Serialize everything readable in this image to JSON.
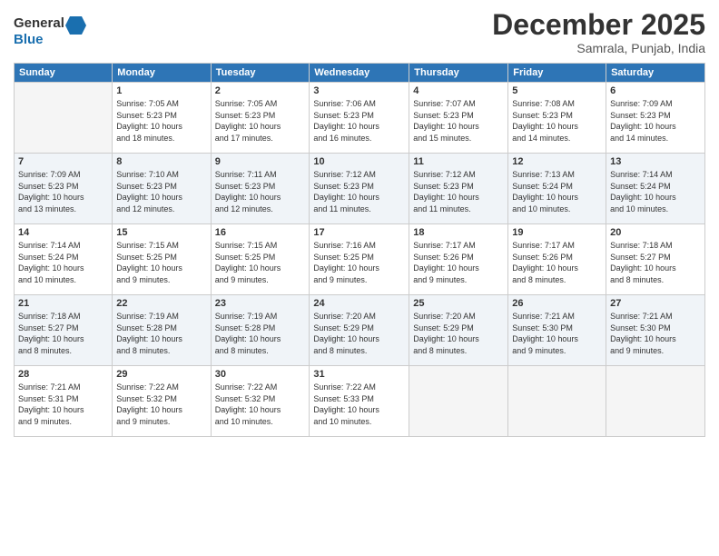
{
  "header": {
    "logo_line1": "General",
    "logo_line2": "Blue",
    "month": "December 2025",
    "location": "Samrala, Punjab, India"
  },
  "weekdays": [
    "Sunday",
    "Monday",
    "Tuesday",
    "Wednesday",
    "Thursday",
    "Friday",
    "Saturday"
  ],
  "weeks": [
    [
      {
        "day": "",
        "info": ""
      },
      {
        "day": "1",
        "info": "Sunrise: 7:05 AM\nSunset: 5:23 PM\nDaylight: 10 hours\nand 18 minutes."
      },
      {
        "day": "2",
        "info": "Sunrise: 7:05 AM\nSunset: 5:23 PM\nDaylight: 10 hours\nand 17 minutes."
      },
      {
        "day": "3",
        "info": "Sunrise: 7:06 AM\nSunset: 5:23 PM\nDaylight: 10 hours\nand 16 minutes."
      },
      {
        "day": "4",
        "info": "Sunrise: 7:07 AM\nSunset: 5:23 PM\nDaylight: 10 hours\nand 15 minutes."
      },
      {
        "day": "5",
        "info": "Sunrise: 7:08 AM\nSunset: 5:23 PM\nDaylight: 10 hours\nand 14 minutes."
      },
      {
        "day": "6",
        "info": "Sunrise: 7:09 AM\nSunset: 5:23 PM\nDaylight: 10 hours\nand 14 minutes."
      }
    ],
    [
      {
        "day": "7",
        "info": "Sunrise: 7:09 AM\nSunset: 5:23 PM\nDaylight: 10 hours\nand 13 minutes."
      },
      {
        "day": "8",
        "info": "Sunrise: 7:10 AM\nSunset: 5:23 PM\nDaylight: 10 hours\nand 12 minutes."
      },
      {
        "day": "9",
        "info": "Sunrise: 7:11 AM\nSunset: 5:23 PM\nDaylight: 10 hours\nand 12 minutes."
      },
      {
        "day": "10",
        "info": "Sunrise: 7:12 AM\nSunset: 5:23 PM\nDaylight: 10 hours\nand 11 minutes."
      },
      {
        "day": "11",
        "info": "Sunrise: 7:12 AM\nSunset: 5:23 PM\nDaylight: 10 hours\nand 11 minutes."
      },
      {
        "day": "12",
        "info": "Sunrise: 7:13 AM\nSunset: 5:24 PM\nDaylight: 10 hours\nand 10 minutes."
      },
      {
        "day": "13",
        "info": "Sunrise: 7:14 AM\nSunset: 5:24 PM\nDaylight: 10 hours\nand 10 minutes."
      }
    ],
    [
      {
        "day": "14",
        "info": "Sunrise: 7:14 AM\nSunset: 5:24 PM\nDaylight: 10 hours\nand 10 minutes."
      },
      {
        "day": "15",
        "info": "Sunrise: 7:15 AM\nSunset: 5:25 PM\nDaylight: 10 hours\nand 9 minutes."
      },
      {
        "day": "16",
        "info": "Sunrise: 7:15 AM\nSunset: 5:25 PM\nDaylight: 10 hours\nand 9 minutes."
      },
      {
        "day": "17",
        "info": "Sunrise: 7:16 AM\nSunset: 5:25 PM\nDaylight: 10 hours\nand 9 minutes."
      },
      {
        "day": "18",
        "info": "Sunrise: 7:17 AM\nSunset: 5:26 PM\nDaylight: 10 hours\nand 9 minutes."
      },
      {
        "day": "19",
        "info": "Sunrise: 7:17 AM\nSunset: 5:26 PM\nDaylight: 10 hours\nand 8 minutes."
      },
      {
        "day": "20",
        "info": "Sunrise: 7:18 AM\nSunset: 5:27 PM\nDaylight: 10 hours\nand 8 minutes."
      }
    ],
    [
      {
        "day": "21",
        "info": "Sunrise: 7:18 AM\nSunset: 5:27 PM\nDaylight: 10 hours\nand 8 minutes."
      },
      {
        "day": "22",
        "info": "Sunrise: 7:19 AM\nSunset: 5:28 PM\nDaylight: 10 hours\nand 8 minutes."
      },
      {
        "day": "23",
        "info": "Sunrise: 7:19 AM\nSunset: 5:28 PM\nDaylight: 10 hours\nand 8 minutes."
      },
      {
        "day": "24",
        "info": "Sunrise: 7:20 AM\nSunset: 5:29 PM\nDaylight: 10 hours\nand 8 minutes."
      },
      {
        "day": "25",
        "info": "Sunrise: 7:20 AM\nSunset: 5:29 PM\nDaylight: 10 hours\nand 8 minutes."
      },
      {
        "day": "26",
        "info": "Sunrise: 7:21 AM\nSunset: 5:30 PM\nDaylight: 10 hours\nand 9 minutes."
      },
      {
        "day": "27",
        "info": "Sunrise: 7:21 AM\nSunset: 5:30 PM\nDaylight: 10 hours\nand 9 minutes."
      }
    ],
    [
      {
        "day": "28",
        "info": "Sunrise: 7:21 AM\nSunset: 5:31 PM\nDaylight: 10 hours\nand 9 minutes."
      },
      {
        "day": "29",
        "info": "Sunrise: 7:22 AM\nSunset: 5:32 PM\nDaylight: 10 hours\nand 9 minutes."
      },
      {
        "day": "30",
        "info": "Sunrise: 7:22 AM\nSunset: 5:32 PM\nDaylight: 10 hours\nand 10 minutes."
      },
      {
        "day": "31",
        "info": "Sunrise: 7:22 AM\nSunset: 5:33 PM\nDaylight: 10 hours\nand 10 minutes."
      },
      {
        "day": "",
        "info": ""
      },
      {
        "day": "",
        "info": ""
      },
      {
        "day": "",
        "info": ""
      }
    ]
  ]
}
